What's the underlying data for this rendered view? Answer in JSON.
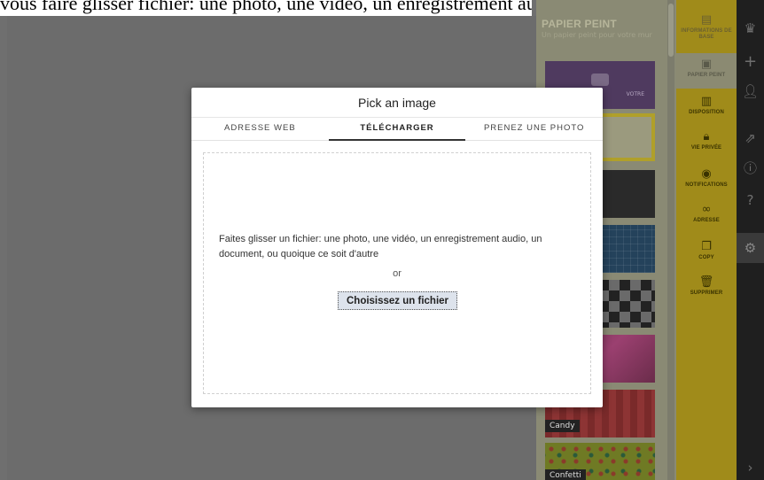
{
  "top_strip": {
    "text": "vous faire glisser fichier: une photo, une vidéo, un enregistrement audio un papier peint"
  },
  "modal": {
    "title": "Pick an image",
    "tabs": [
      {
        "label": "ADRESSE WEB"
      },
      {
        "label": "TÉLÉCHARGER"
      },
      {
        "label": "PRENEZ UNE PHOTO"
      }
    ],
    "active_tab": "TÉLÉCHARGER",
    "dropzone": {
      "instructions": "Faites glisser un fichier: une photo, une vidéo, un enregistrement audio, un document, ou quoique ce soit d'autre",
      "or_text": "or",
      "button_label": "Choisissez un fichier"
    }
  },
  "wallpaper_panel": {
    "title": "PAPIER PEINT",
    "subtitle": "Un papier peint pour votre mur",
    "tiles": [
      {
        "label": ""
      },
      {
        "label": ""
      },
      {
        "label": ""
      },
      {
        "label": ""
      },
      {
        "label": ""
      },
      {
        "label": ""
      },
      {
        "label": "Candy"
      },
      {
        "label": "Confetti"
      }
    ],
    "tile1_caption": "VOTRE"
  },
  "side_bar": {
    "items": [
      {
        "label": "INFORMATIONS DE BASE",
        "icon": "info-card-icon"
      },
      {
        "label": "PAPIER PEINT",
        "icon": "image-icon"
      },
      {
        "label": "DISPOSITION",
        "icon": "layout-icon"
      },
      {
        "label": "VIE PRIVÉE",
        "icon": "lock-icon"
      },
      {
        "label": "NOTIFICATIONS",
        "icon": "eye-icon"
      },
      {
        "label": "ADRESSE",
        "icon": "link-icon"
      },
      {
        "label": "COPY",
        "icon": "copy-icon"
      },
      {
        "label": "SUPPRIMER",
        "icon": "trash-icon"
      }
    ]
  },
  "colors": {
    "canvas": "#6c6c6c",
    "side_bar": "#a08b1a",
    "dark_bar": "#1f1f1f",
    "modal_bg": "#ffffff"
  }
}
